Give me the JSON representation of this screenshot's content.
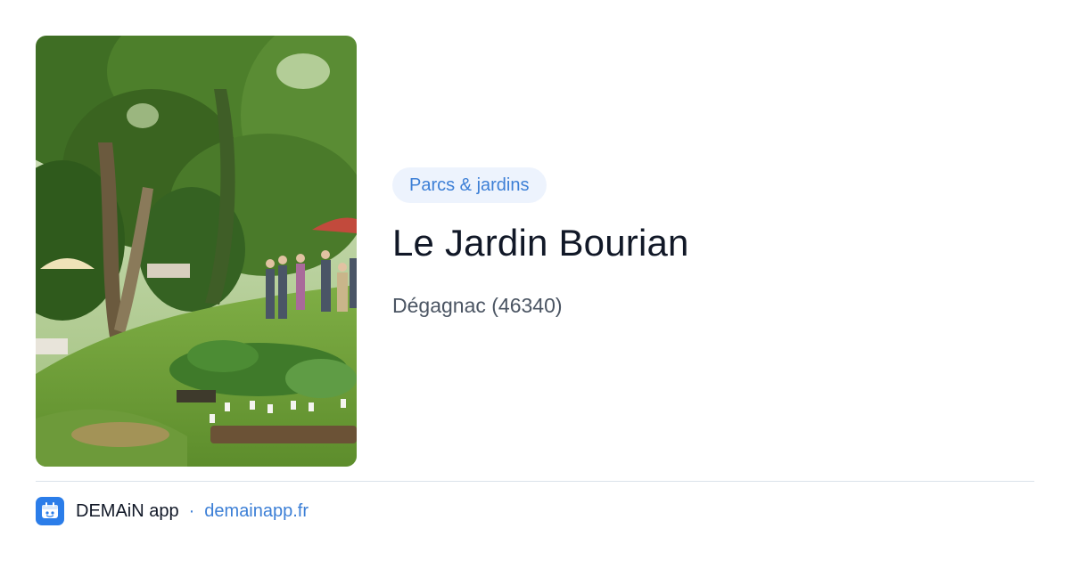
{
  "card": {
    "image_alt": "Le Jardin Bourian",
    "category": "Parcs & jardins",
    "title": "Le Jardin Bourian",
    "location": "Dégagnac (46340)"
  },
  "footer": {
    "app_name": "DEMAiN app",
    "separator": "·",
    "url": "demainapp.fr",
    "logo_icon": "demain-app-logo-icon"
  },
  "colors": {
    "accent": "#3c7fd6",
    "tag_background": "#edf3fd",
    "title": "#111827",
    "muted_text": "#4b5563",
    "logo": "#2b7de9"
  }
}
